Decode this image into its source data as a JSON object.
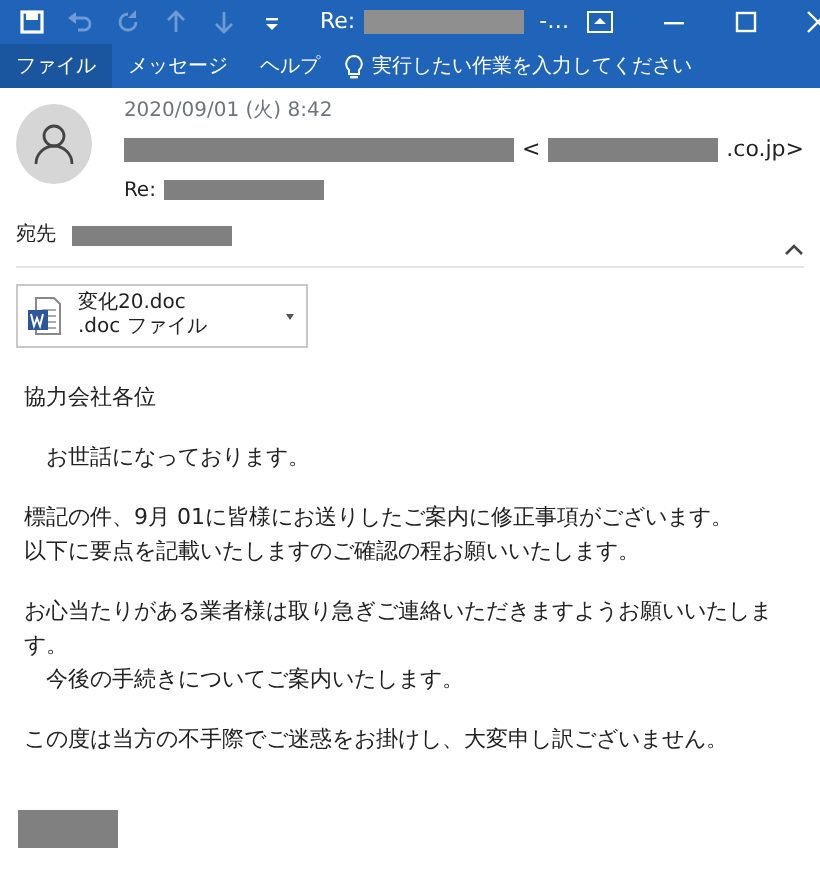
{
  "window": {
    "title_prefix": "Re:",
    "title_redacted": true,
    "title_suffix": "-…",
    "quick_access": [
      {
        "kind": "save",
        "disabled": false
      },
      {
        "kind": "undo",
        "disabled": true
      },
      {
        "kind": "redo",
        "disabled": true
      },
      {
        "kind": "up",
        "disabled": true
      },
      {
        "kind": "down",
        "disabled": true
      },
      {
        "kind": "customize",
        "disabled": false
      }
    ]
  },
  "menu": [
    {
      "label": "ファイル",
      "selected": true
    },
    {
      "label": "メッセージ",
      "selected": false
    },
    {
      "label": "ヘルプ",
      "selected": false
    }
  ],
  "tell_me": {
    "placeholder": "実行したい作業を入力してください"
  },
  "message": {
    "date": "2020/09/01 (火) 8:42",
    "sender_redacted": true,
    "email_open": "<",
    "email_redacted": true,
    "email_close": ".co.jp>",
    "subject_prefix": "Re:",
    "subject_redacted": true,
    "to_label": "宛先",
    "to_redacted": true
  },
  "attachment": {
    "name": "変化20.doc",
    "type": ".doc ファイル"
  },
  "body": [
    {
      "lines": [
        "協力会社各位"
      ]
    },
    {
      "lines": [
        "　お世話になっております。"
      ]
    },
    {
      "lines": [
        "標記の件、9月 01に皆様にお送りしたご案内に修正事項がございます。",
        "以下に要点を記載いたしますのご確認の程お願いいたします。"
      ]
    },
    {
      "lines": [
        "お心当たりがある業者様は取り急ぎご連絡いただきますようお願いいたしま",
        "す。",
        "　今後の手続きについてご案内いたします。"
      ]
    },
    {
      "lines": [
        "この度は当方の不手際でご迷惑をお掛けし、大変申し訳ございません。"
      ]
    }
  ],
  "signature_redacted": true
}
